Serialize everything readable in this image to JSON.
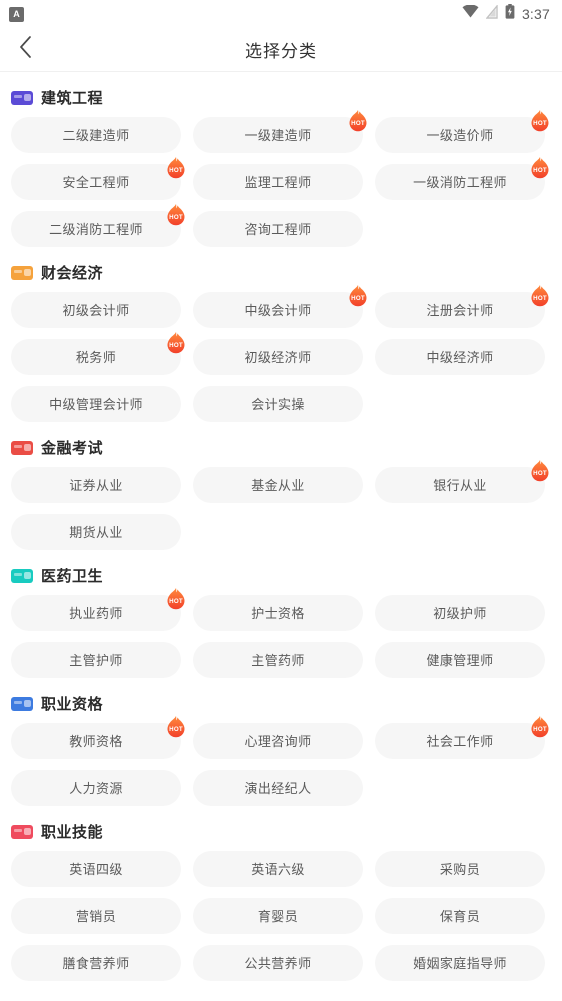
{
  "statusbar": {
    "app_icon_letter": "A",
    "wifi_icon": "wifi-icon",
    "signal_icon": "signal-icon",
    "battery_icon": "battery-icon",
    "time": "3:37"
  },
  "navbar": {
    "back_icon": "chevron-left-icon",
    "title": "选择分类"
  },
  "hot_label": "HOT",
  "sections": [
    {
      "title": "建筑工程",
      "icon_color": "#5b4bd6",
      "icon_name": "category-icon-construction",
      "items": [
        {
          "label": "二级建造师",
          "hot": false
        },
        {
          "label": "一级建造师",
          "hot": true
        },
        {
          "label": "一级造价师",
          "hot": true
        },
        {
          "label": "安全工程师",
          "hot": true
        },
        {
          "label": "监理工程师",
          "hot": false
        },
        {
          "label": "一级消防工程师",
          "hot": true
        },
        {
          "label": "二级消防工程师",
          "hot": true
        },
        {
          "label": "咨询工程师",
          "hot": false
        }
      ]
    },
    {
      "title": "财会经济",
      "icon_color": "#f5a23c",
      "icon_name": "category-icon-finance-accounting",
      "items": [
        {
          "label": "初级会计师",
          "hot": false
        },
        {
          "label": "中级会计师",
          "hot": true
        },
        {
          "label": "注册会计师",
          "hot": true
        },
        {
          "label": "税务师",
          "hot": true
        },
        {
          "label": "初级经济师",
          "hot": false
        },
        {
          "label": "中级经济师",
          "hot": false
        },
        {
          "label": "中级管理会计师",
          "hot": false
        },
        {
          "label": "会计实操",
          "hot": false
        }
      ]
    },
    {
      "title": "金融考试",
      "icon_color": "#ea4d45",
      "icon_name": "category-icon-financial-exam",
      "items": [
        {
          "label": "证券从业",
          "hot": false
        },
        {
          "label": "基金从业",
          "hot": false
        },
        {
          "label": "银行从业",
          "hot": true
        },
        {
          "label": "期货从业",
          "hot": false
        }
      ]
    },
    {
      "title": "医药卫生",
      "icon_color": "#18cbc0",
      "icon_name": "category-icon-medical-health",
      "items": [
        {
          "label": "执业药师",
          "hot": true
        },
        {
          "label": "护士资格",
          "hot": false
        },
        {
          "label": "初级护师",
          "hot": false
        },
        {
          "label": "主管护师",
          "hot": false
        },
        {
          "label": "主管药师",
          "hot": false
        },
        {
          "label": "健康管理师",
          "hot": false
        }
      ]
    },
    {
      "title": "职业资格",
      "icon_color": "#3d7be0",
      "icon_name": "category-icon-professional-qualification",
      "items": [
        {
          "label": "教师资格",
          "hot": true
        },
        {
          "label": "心理咨询师",
          "hot": false
        },
        {
          "label": "社会工作师",
          "hot": true
        },
        {
          "label": "人力资源",
          "hot": false
        },
        {
          "label": "演出经纪人",
          "hot": false
        }
      ]
    },
    {
      "title": "职业技能",
      "icon_color": "#ef4b5e",
      "icon_name": "category-icon-vocational-skill",
      "items": [
        {
          "label": "英语四级",
          "hot": false
        },
        {
          "label": "英语六级",
          "hot": false
        },
        {
          "label": "采购员",
          "hot": false
        },
        {
          "label": "营销员",
          "hot": false
        },
        {
          "label": "育婴员",
          "hot": false
        },
        {
          "label": "保育员",
          "hot": false
        },
        {
          "label": "膳食营养师",
          "hot": false
        },
        {
          "label": "公共营养师",
          "hot": false
        },
        {
          "label": "婚姻家庭指导师",
          "hot": false
        }
      ]
    }
  ]
}
